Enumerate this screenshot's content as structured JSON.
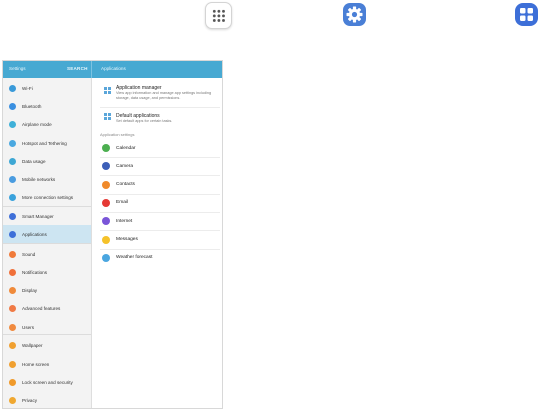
{
  "header": {
    "settings_title": "Settings",
    "search_label": "SEARCH",
    "panel_title": "Applications"
  },
  "icons": {
    "step1": "apps-icon",
    "step2": "settings-gear-icon",
    "step3": "applications-grid-icon"
  },
  "sidebar": {
    "items": [
      {
        "label": "Wi-Fi",
        "color": "#3a9ad9"
      },
      {
        "label": "Bluetooth",
        "color": "#3a8fe0"
      },
      {
        "label": "Airplane mode",
        "color": "#3fb0d8"
      },
      {
        "label": "Hotspot and Tethering",
        "color": "#4aa8e0"
      },
      {
        "label": "Data usage",
        "color": "#3da7d4"
      },
      {
        "label": "Mobile networks",
        "color": "#4a9ce0"
      },
      {
        "label": "More connection settings",
        "color": "#3aa2dc"
      },
      {
        "label": "Smart Manager",
        "color": "#3f6fd8"
      },
      {
        "label": "Applications",
        "color": "#3d6fd8",
        "active": true
      },
      {
        "label": "Sound",
        "color": "#f07a3a"
      },
      {
        "label": "Notifications",
        "color": "#f0703a"
      },
      {
        "label": "Display",
        "color": "#f08a3a"
      },
      {
        "label": "Advanced features",
        "color": "#f07a45"
      },
      {
        "label": "Users",
        "color": "#f08a3f"
      },
      {
        "label": "Wallpaper",
        "color": "#f0a030"
      },
      {
        "label": "Home screen",
        "color": "#f0a030"
      },
      {
        "label": "Lock screen and security",
        "color": "#f09a2a"
      },
      {
        "label": "Privacy",
        "color": "#f0a830"
      }
    ]
  },
  "panel": {
    "app_manager": {
      "title": "Application manager",
      "subtitle": "View app information and manage app settings including storage, data usage, and permissions."
    },
    "default_apps": {
      "title": "Default applications",
      "subtitle": "Set default apps for certain tasks."
    },
    "section_header": "Application settings",
    "apps": [
      {
        "label": "Calendar",
        "color": "#4caf50",
        "icon": "calendar-icon"
      },
      {
        "label": "Camera",
        "color": "#3d5fb8",
        "icon": "camera-icon"
      },
      {
        "label": "Contacts",
        "color": "#f08a2a",
        "icon": "contacts-icon"
      },
      {
        "label": "Email",
        "color": "#e53935",
        "icon": "email-icon"
      },
      {
        "label": "Internet",
        "color": "#7a55d8",
        "icon": "internet-icon"
      },
      {
        "label": "Messages",
        "color": "#f5c22a",
        "icon": "messages-icon"
      },
      {
        "label": "Weather forecast",
        "color": "#4aa6e0",
        "icon": "weather-icon"
      }
    ]
  }
}
